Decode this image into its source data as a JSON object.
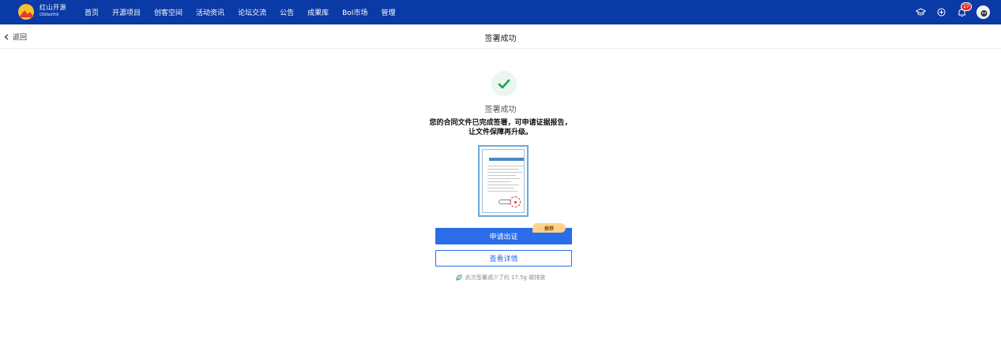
{
  "app": {
    "brand_name": "红山开源",
    "brand_sub": "OSRedHill"
  },
  "nav": {
    "items": [
      "首页",
      "开源项目",
      "创客空间",
      "活动资讯",
      "论坛交流",
      "公告",
      "成果库",
      "BoI市场",
      "管理"
    ]
  },
  "header_right": {
    "notification_count": "17"
  },
  "subbar": {
    "back_label": "返回",
    "title": "签署成功"
  },
  "main": {
    "success_title": "签署成功",
    "description_line1": "您的合同文件已完成签署，可申请证据报告，",
    "description_line2": "让文件保障再升级。",
    "primary_button": "申请出证",
    "recommend_tag": "推荐",
    "secondary_button": "查看详情",
    "eco_note": "此次签署减少了约 17.5g 碳排放"
  },
  "colors": {
    "nav_bg": "#0a3aa6",
    "primary": "#2b6de8",
    "success": "#1aa05a",
    "tag_bg": "#ffd28a"
  }
}
